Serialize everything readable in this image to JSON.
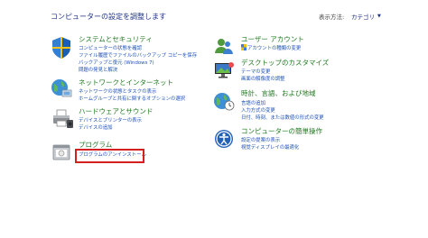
{
  "header": {
    "title": "コンピューターの設定を調整します",
    "view_by_label": "表示方法:",
    "view_by_value": "カテゴリ"
  },
  "left": [
    {
      "icon": "shield-icon",
      "heading": "システムとセキュリティ",
      "links": [
        "コンピューターの状態を確認",
        "ファイル履歴でファイルのバックアップ コピーを保存",
        "バックアップと復元 (Windows 7)",
        "問題の発見と解決"
      ]
    },
    {
      "icon": "network-icon",
      "heading": "ネットワークとインターネット",
      "links": [
        "ネットワークの状態とタスクの表示",
        "ホームグループと共有に関するオプションの選択"
      ]
    },
    {
      "icon": "printer-icon",
      "heading": "ハードウェアとサウンド",
      "links": [
        "デバイスとプリンターの表示",
        "デバイスの追加"
      ]
    },
    {
      "icon": "programs-icon",
      "heading": "プログラム",
      "links": [
        "プログラムのアンインストール"
      ]
    }
  ],
  "right": [
    {
      "icon": "users-icon",
      "heading": "ユーザー アカウント",
      "links": [
        "アカウントの種類の変更"
      ]
    },
    {
      "icon": "desktop-icon",
      "heading": "デスクトップのカスタマイズ",
      "links": [
        "テーマの変更",
        "画面の解像度の調整"
      ]
    },
    {
      "icon": "globe-clock-icon",
      "heading": "時計、言語、および地域",
      "links": [
        "言語の追加",
        "入力方式の変更",
        "日付、時刻、または数値の形式の変更"
      ]
    },
    {
      "icon": "ease-of-access-icon",
      "heading": "コンピューターの簡単操作",
      "links": [
        "設定の提案の表示",
        "視覚ディスプレイの最適化"
      ]
    }
  ],
  "colors": {
    "heading": "#1f7a1f",
    "link": "#1e52b8",
    "title": "#1e3287",
    "highlight": "#d62020"
  }
}
